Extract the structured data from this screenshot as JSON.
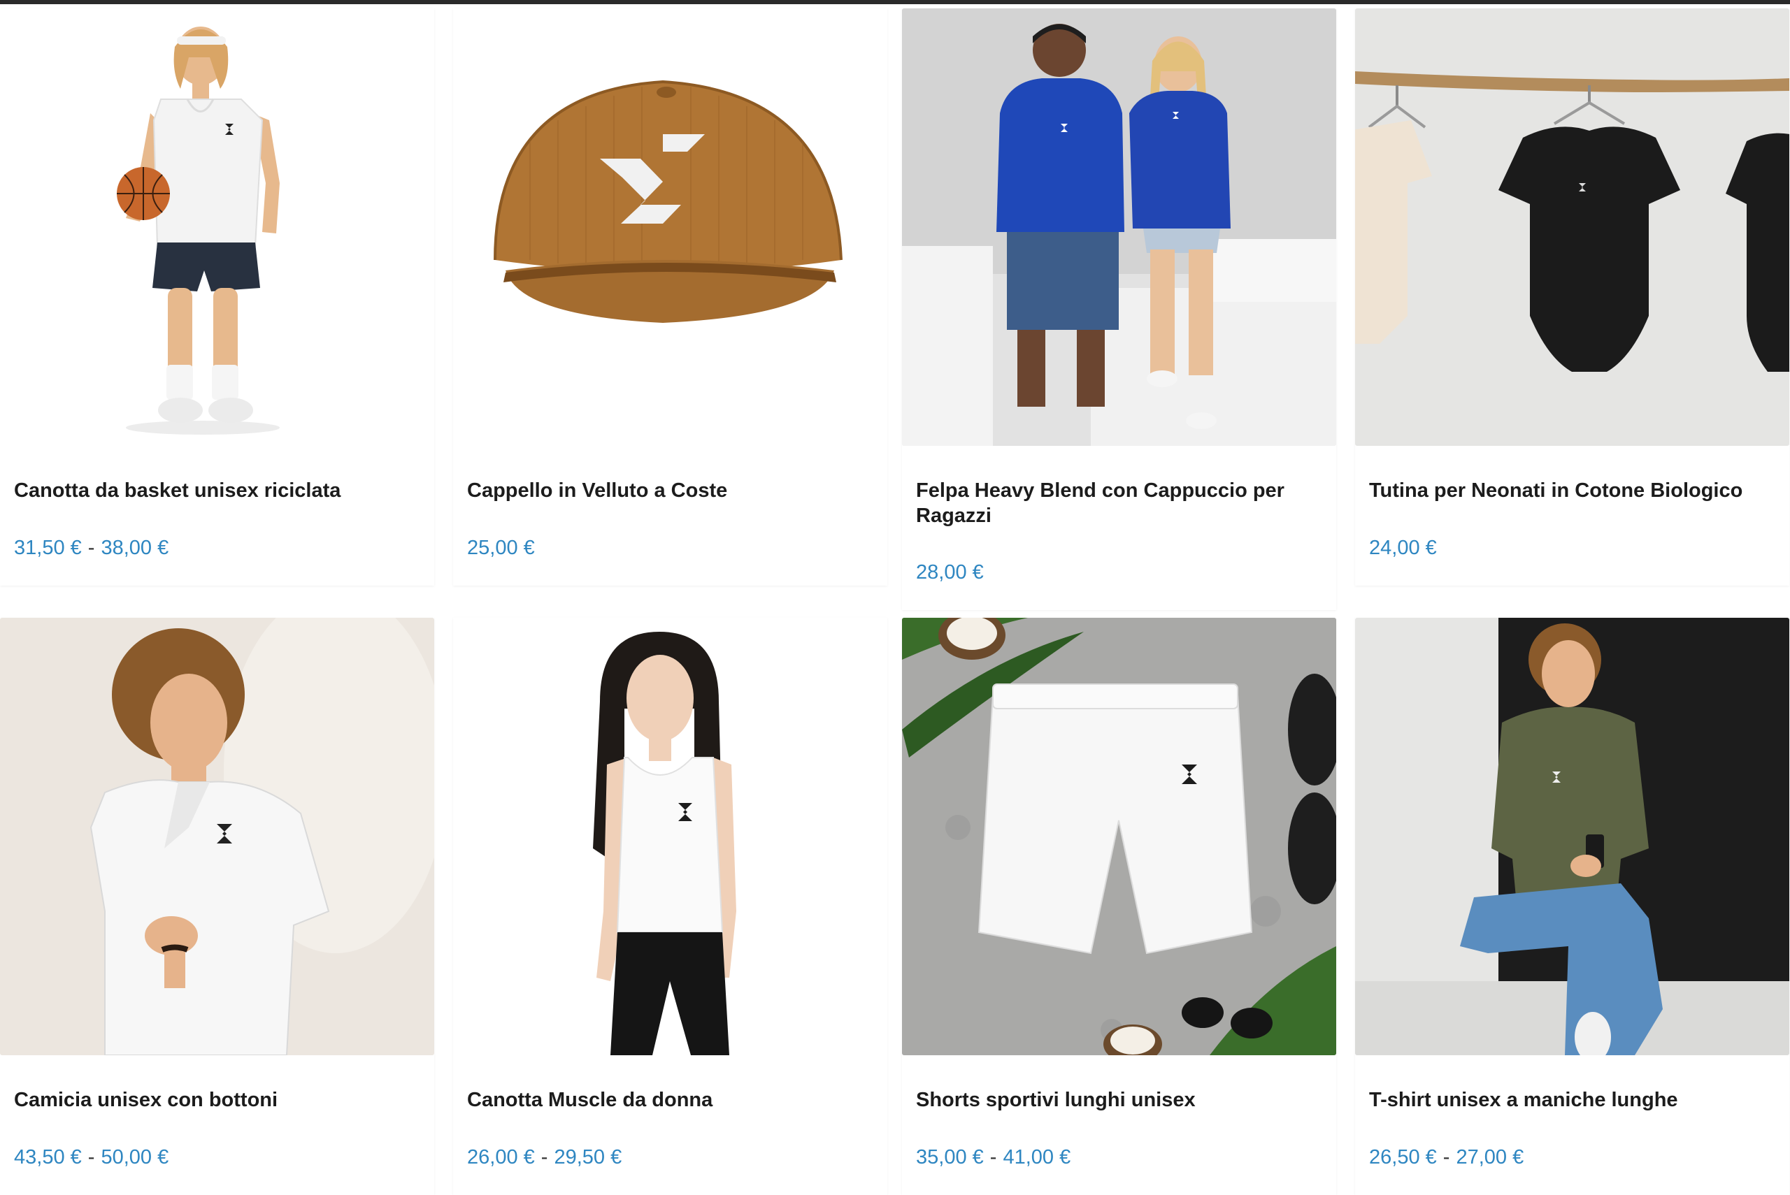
{
  "colors": {
    "price": "#2e86c1",
    "title": "#1c1c1c",
    "separator": "#333333"
  },
  "products": [
    {
      "title": "Canotta da basket unisex riciclata",
      "price_min": "31,50 €",
      "price_sep": "-",
      "price_max": "38,00 €",
      "image": "woman-basketball-tank"
    },
    {
      "title": "Cappello in Velluto a Coste",
      "price_min": "25,00 €",
      "price_sep": "",
      "price_max": "",
      "image": "corduroy-cap"
    },
    {
      "title": "Felpa Heavy Blend con Cappuccio per Ragazzi",
      "price_min": "28,00 €",
      "price_sep": "",
      "price_max": "",
      "image": "kids-blue-hoodies"
    },
    {
      "title": "Tutina per Neonati in Cotone Biologico",
      "price_min": "24,00 €",
      "price_sep": "",
      "price_max": "",
      "image": "baby-bodysuits-hanger"
    },
    {
      "title": "Camicia unisex con bottoni",
      "price_min": "43,50 €",
      "price_sep": "-",
      "price_max": "50,00 €",
      "image": "white-button-shirt"
    },
    {
      "title": "Canotta Muscle da donna",
      "price_min": "26,00 €",
      "price_sep": "-",
      "price_max": "29,50 €",
      "image": "women-muscle-tank"
    },
    {
      "title": "Shorts sportivi lunghi unisex",
      "price_min": "35,00 €",
      "price_sep": "-",
      "price_max": "41,00 €",
      "image": "white-shorts-flatlay"
    },
    {
      "title": "T-shirt unisex a maniche lunghe",
      "price_min": "26,50 €",
      "price_sep": "-",
      "price_max": "27,00 €",
      "image": "olive-long-sleeve"
    }
  ]
}
